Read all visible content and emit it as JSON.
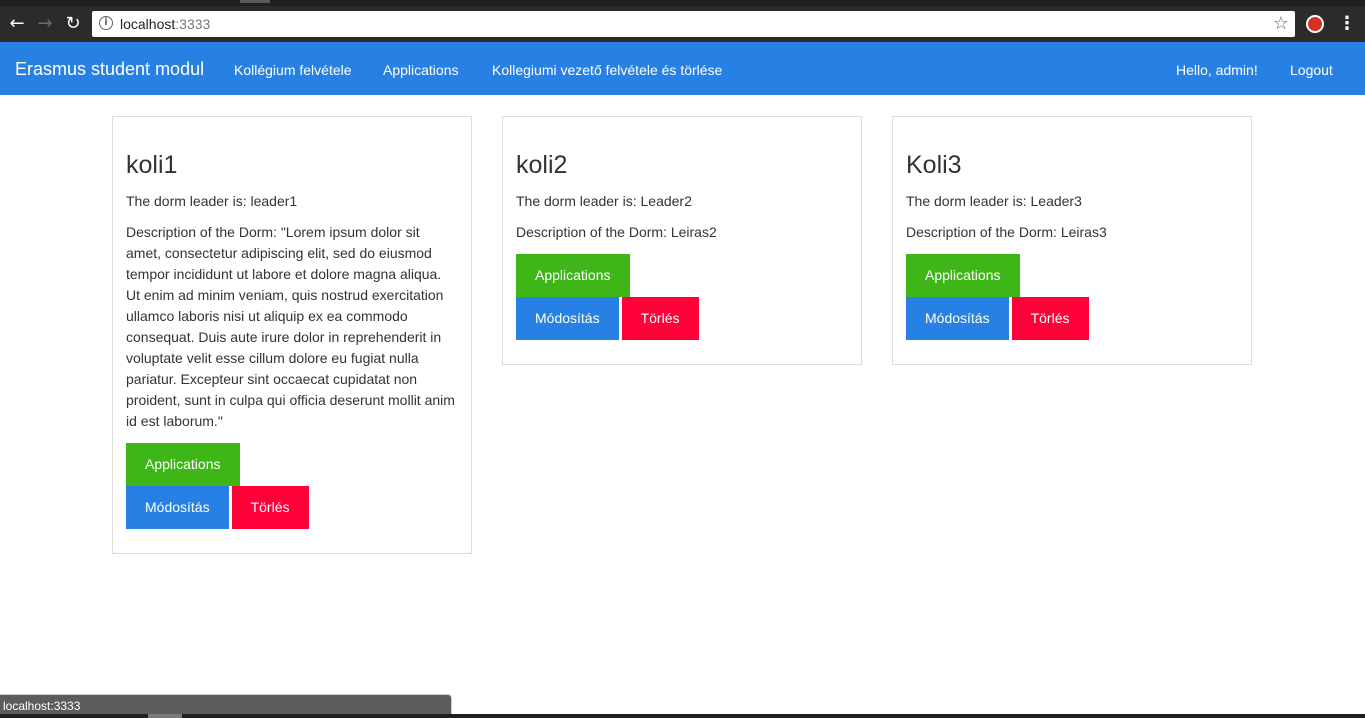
{
  "browser": {
    "url_host": "localhost",
    "url_port": ":3333",
    "status_text": "localhost:3333"
  },
  "navbar": {
    "brand": "Erasmus student modul",
    "links": [
      "Kollégium felvétele",
      "Applications",
      "Kollegiumi vezető felvétele és törlése"
    ],
    "greeting": "Hello, admin!",
    "logout": "Logout"
  },
  "cards": [
    {
      "title": "koli1",
      "leader": "The dorm leader is: leader1",
      "description": "Description of the Dorm: \"Lorem ipsum dolor sit amet, consectetur adipiscing elit, sed do eiusmod tempor incididunt ut labore et dolore magna aliqua. Ut enim ad minim veniam, quis nostrud exercitation ullamco laboris nisi ut aliquip ex ea commodo consequat. Duis aute irure dolor in reprehenderit in voluptate velit esse cillum dolore eu fugiat nulla pariatur. Excepteur sint occaecat cupidatat non proident, sunt in culpa qui officia deserunt mollit anim id est laborum.\"",
      "applications_label": "Applications",
      "edit_label": "Módosítás",
      "delete_label": "Törlés"
    },
    {
      "title": "koli2",
      "leader": "The dorm leader is: Leader2",
      "description": "Description of the Dorm: Leiras2",
      "applications_label": "Applications",
      "edit_label": "Módosítás",
      "delete_label": "Törlés"
    },
    {
      "title": "Koli3",
      "leader": "The dorm leader is: Leader3",
      "description": "Description of the Dorm: Leiras3",
      "applications_label": "Applications",
      "edit_label": "Módosítás",
      "delete_label": "Törlés"
    }
  ],
  "icons": {
    "back": "back-arrow-icon",
    "forward": "forward-arrow-icon",
    "reload": "reload-icon",
    "info": "info-icon",
    "star": "bookmark-star-icon",
    "extension": "extension-icon",
    "menu": "kebab-menu-icon"
  },
  "colors": {
    "navbar": "#2780e3",
    "success": "#3fb618",
    "primary": "#2780e3",
    "danger": "#ff0039"
  }
}
